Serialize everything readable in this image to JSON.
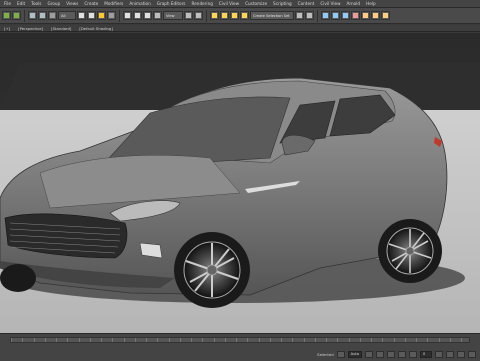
{
  "app": {
    "menu": [
      "File",
      "Edit",
      "Tools",
      "Group",
      "Views",
      "Create",
      "Modifiers",
      "Animation",
      "Graph Editors",
      "Rendering",
      "Civil View",
      "Customize",
      "Scripting",
      "Content",
      "Civil View",
      "Arnold",
      "Help"
    ]
  },
  "toolbar": {
    "selection_filter": "All",
    "view_dropdown": "View",
    "selection_set": "Create Selection Set"
  },
  "subbar": {
    "items": [
      "[+]",
      "[Perspective]",
      "[Standard]",
      "[Default Shading]"
    ]
  },
  "viewport": {
    "background_top": "#2a2a2a",
    "floor_color": "#bdbdbd",
    "car_color": "#7a7a7a"
  },
  "status": {
    "frame_value": "0",
    "mode_label": "Auto",
    "selected_label": "Selected"
  }
}
